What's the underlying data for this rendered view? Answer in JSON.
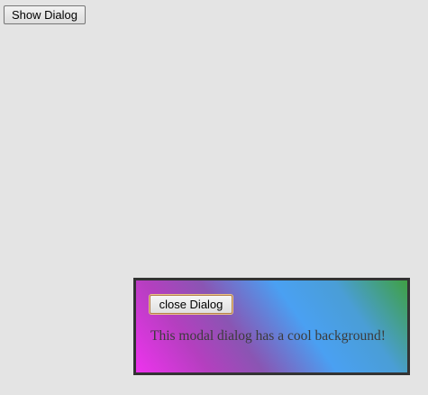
{
  "page": {
    "background": "#e4e4e4"
  },
  "toolbar": {
    "show_label": "Show Dialog"
  },
  "dialog": {
    "close_label": "close Dialog",
    "message": "This modal dialog has a cool background!",
    "border_color": "#333333",
    "gradient_colors": [
      "#ee33ee",
      "#b43fbf",
      "#8a55b3",
      "#4aa0f2",
      "#4a9ed6",
      "#3fa044"
    ]
  }
}
